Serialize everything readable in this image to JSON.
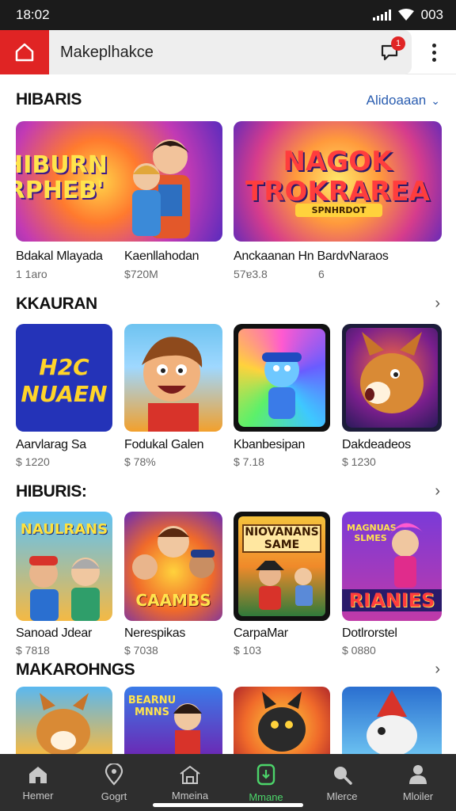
{
  "status_bar": {
    "time": "18:02",
    "battery": "003"
  },
  "app_bar": {
    "search_text": "Makeplhakce",
    "chat_badge": "1"
  },
  "sections": [
    {
      "title": "HIBARIS",
      "link_label": "Alidoaaan",
      "items": [
        {
          "art_text": "HIBURN RPHEB'",
          "title": "Bdakal Mlayada",
          "price": "1 1aro"
        },
        {
          "art_text": "Kaenllahodan",
          "title": "",
          "price": "$720M"
        },
        {
          "art_text": "NAGOK TROKRAREA",
          "art_subtext": "SPNHRDOT",
          "title": "Anckaanan Hn BardvNaraos",
          "price": "57ɐ3.8"
        },
        {
          "title": "",
          "price": "6"
        }
      ]
    },
    {
      "title": "KKAURAN",
      "items": [
        {
          "art_text": "H2C NUAEN",
          "title": "Aarvlarag Sa",
          "price": "$ 1220"
        },
        {
          "title": "Fodukal Galen",
          "price": "$ 78%"
        },
        {
          "title": "Kbanbesipan",
          "price": "$ 7.18"
        },
        {
          "title": "Dakdeadeos",
          "price": "$ 1230"
        }
      ]
    },
    {
      "title": "HIBURIS:",
      "items": [
        {
          "art_text": "NAULRANS",
          "title": "Sanoad Jdear",
          "price": "$ 7818"
        },
        {
          "art_text": "CAAMBS",
          "title": "Nerespikas",
          "price": "$ 7038"
        },
        {
          "art_text": "NIOVANANS SAME",
          "title": "CarpaMar",
          "price": "$ 103"
        },
        {
          "art_text": "RIANIES",
          "art_subtext": "MAGNUAS SLMES",
          "title": "Dotlrorstel",
          "price": "$ 0880"
        }
      ]
    },
    {
      "title": "MAKAROHNGS",
      "items": [
        {
          "art_text": ""
        },
        {
          "art_text": "BEARNU MNNS"
        },
        {
          "art_text": ""
        },
        {
          "art_text": ""
        }
      ]
    }
  ],
  "bottom_nav": [
    {
      "label": "Hemer",
      "icon": "home-icon"
    },
    {
      "label": "Gogrt",
      "icon": "location-pin-icon"
    },
    {
      "label": "Mmeina",
      "icon": "store-icon"
    },
    {
      "label": "Mmane",
      "icon": "game-controller-icon",
      "active": true
    },
    {
      "label": "Mlerce",
      "icon": "search-icon"
    },
    {
      "label": "Mloiler",
      "icon": "profile-icon"
    }
  ],
  "colors": {
    "accent_red": "#e02424",
    "nav_active": "#4cd46a",
    "link_blue": "#2a5db0"
  }
}
